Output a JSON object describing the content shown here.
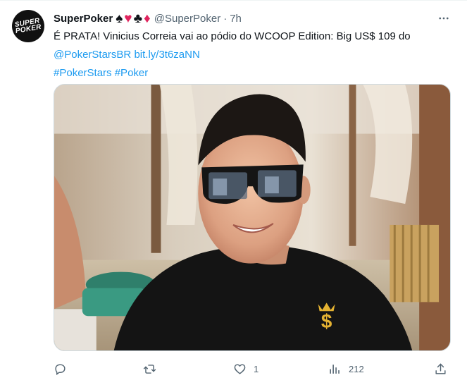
{
  "tweet": {
    "display_name": "SuperPoker",
    "name_suffix_icons": [
      "spade-icon",
      "heart-icon",
      "club-icon",
      "diamond-icon"
    ],
    "suits": {
      "spade": "♠",
      "heart": "♥",
      "club": "♣",
      "diamond": "♦"
    },
    "handle": "@SuperPoker",
    "separator": "·",
    "time": "7h",
    "avatar_text": [
      "SUPER",
      "POKER"
    ],
    "text": {
      "line1": "É PRATA! Vinicius Correia vai ao pódio do WCOOP Edition: Big US$ 109 do",
      "mention": "@PokerStarsBR",
      "url": "bit.ly/3t6zaNN",
      "hashtag1": "#PokerStars",
      "hashtag2": "#Poker"
    },
    "media": {
      "shirt_logo": "$"
    },
    "actions": {
      "reply": {
        "icon": "reply-icon",
        "count": ""
      },
      "retweet": {
        "icon": "retweet-icon",
        "count": ""
      },
      "like": {
        "icon": "heart-outline-icon",
        "count": "1"
      },
      "views": {
        "icon": "views-icon",
        "count": "212"
      },
      "share": {
        "icon": "share-icon"
      }
    },
    "colors": {
      "link": "#1d9bf0",
      "text": "#0f1419",
      "muted": "#536471",
      "suit_red": "#e0245e"
    }
  }
}
